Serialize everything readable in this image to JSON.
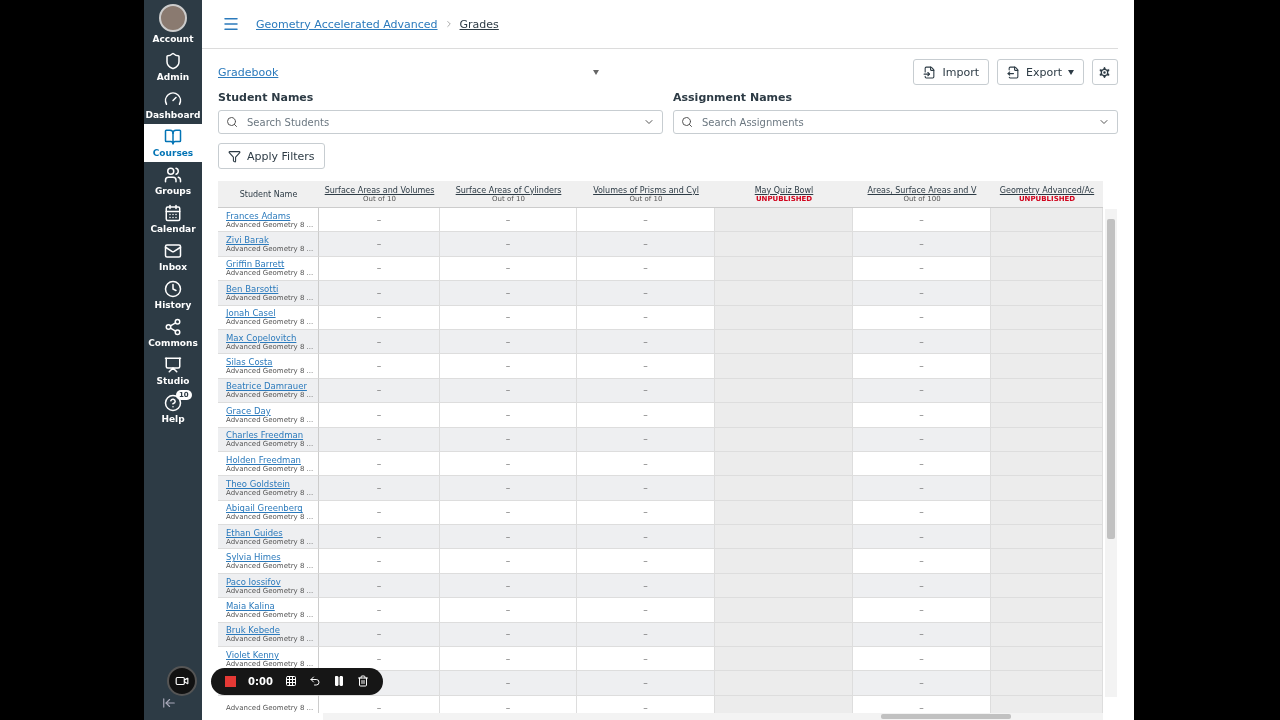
{
  "sidebar": {
    "items": [
      {
        "label": "Account",
        "selected": false
      },
      {
        "label": "Admin",
        "selected": false
      },
      {
        "label": "Dashboard",
        "selected": false
      },
      {
        "label": "Courses",
        "selected": true
      },
      {
        "label": "Groups",
        "selected": false
      },
      {
        "label": "Calendar",
        "selected": false
      },
      {
        "label": "Inbox",
        "selected": false
      },
      {
        "label": "History",
        "selected": false
      },
      {
        "label": "Commons",
        "selected": false
      },
      {
        "label": "Studio",
        "selected": false
      },
      {
        "label": "Help",
        "badge": "10",
        "selected": false
      }
    ]
  },
  "breadcrumb": [
    "Geometry Accelerated Advanced",
    "Grades"
  ],
  "gradebook_menu": "Gradebook",
  "buttons": {
    "import": "Import",
    "export": "Export"
  },
  "filters": {
    "students_label": "Student Names",
    "students_placeholder": "Search Students",
    "assignments_label": "Assignment Names",
    "assignments_placeholder": "Search Assignments",
    "apply": "Apply Filters"
  },
  "table": {
    "student_header": "Student Name",
    "columns": [
      {
        "title": "Surface Areas and Volumes",
        "sub": "Out of 10",
        "published": true
      },
      {
        "title": "Surface Areas of Cylinders",
        "sub": "Out of 10",
        "published": true
      },
      {
        "title": "Volumes of Prisms and Cyl",
        "sub": "Out of 10",
        "published": true
      },
      {
        "title": "May Quiz Bowl",
        "sub": "UNPUBLISHED",
        "published": false
      },
      {
        "title": "Areas, Surface Areas and V",
        "sub": "Out of 100",
        "published": true
      },
      {
        "title": "Geometry Advanced/Ac",
        "sub": "UNPUBLISHED",
        "published": false
      }
    ],
    "rows": [
      {
        "name": "Frances Adams",
        "section": "Advanced Geometry 8 ...",
        "grades": [
          "–",
          "–",
          "–",
          "–"
        ]
      },
      {
        "name": "Zivi Barak",
        "section": "Advanced Geometry 8 ...",
        "grades": [
          "–",
          "–",
          "–",
          "–"
        ]
      },
      {
        "name": "Griffin Barrett",
        "section": "Advanced Geometry 8 ...",
        "grades": [
          "–",
          "–",
          "–",
          "–"
        ]
      },
      {
        "name": "Ben Barsotti",
        "section": "Advanced Geometry 8 ...",
        "grades": [
          "–",
          "–",
          "–",
          "–"
        ]
      },
      {
        "name": "Jonah Casel",
        "section": "Advanced Geometry 8 ...",
        "grades": [
          "–",
          "–",
          "–",
          "–"
        ]
      },
      {
        "name": "Max Copelovitch",
        "section": "Advanced Geometry 8 ...",
        "grades": [
          "–",
          "–",
          "–",
          "–"
        ]
      },
      {
        "name": "Silas Costa",
        "section": "Advanced Geometry 8 ...",
        "grades": [
          "–",
          "–",
          "–",
          "–"
        ]
      },
      {
        "name": "Beatrice Damrauer",
        "section": "Advanced Geometry 8 ...",
        "grades": [
          "–",
          "–",
          "–",
          "–"
        ]
      },
      {
        "name": "Grace Day",
        "section": "Advanced Geometry 8 ...",
        "grades": [
          "–",
          "–",
          "–",
          "–"
        ]
      },
      {
        "name": "Charles Freedman",
        "section": "Advanced Geometry 8 ...",
        "grades": [
          "–",
          "–",
          "–",
          "–"
        ]
      },
      {
        "name": "Holden Freedman",
        "section": "Advanced Geometry 8 ...",
        "grades": [
          "–",
          "–",
          "–",
          "–"
        ]
      },
      {
        "name": "Theo Goldstein",
        "section": "Advanced Geometry 8 ...",
        "grades": [
          "–",
          "–",
          "–",
          "–"
        ]
      },
      {
        "name": "Abigail Greenberg",
        "section": "Advanced Geometry 8 ...",
        "grades": [
          "–",
          "–",
          "–",
          "–"
        ]
      },
      {
        "name": "Ethan Guides",
        "section": "Advanced Geometry 8 ...",
        "grades": [
          "–",
          "–",
          "–",
          "–"
        ]
      },
      {
        "name": "Sylvia Himes",
        "section": "Advanced Geometry 8 ...",
        "grades": [
          "–",
          "–",
          "–",
          "–"
        ]
      },
      {
        "name": "Paco Iossifov",
        "section": "Advanced Geometry 8 ...",
        "grades": [
          "–",
          "–",
          "–",
          "–"
        ]
      },
      {
        "name": "Maia Kalina",
        "section": "Advanced Geometry 8 ...",
        "grades": [
          "–",
          "–",
          "–",
          "–"
        ]
      },
      {
        "name": "Bruk Kebede",
        "section": "Advanced Geometry 8 ...",
        "grades": [
          "–",
          "–",
          "–",
          "–"
        ]
      },
      {
        "name": "Violet Kenny",
        "section": "Advanced Geometry 8 ...",
        "grades": [
          "–",
          "–",
          "–",
          "–"
        ]
      },
      {
        "grades": [
          "–",
          "–",
          "–"
        ]
      },
      {
        "section": "Advanced Geometry 8 ...",
        "grades": [
          "–",
          "–",
          "–",
          "–"
        ]
      }
    ]
  },
  "recorder": {
    "time": "0:00"
  }
}
